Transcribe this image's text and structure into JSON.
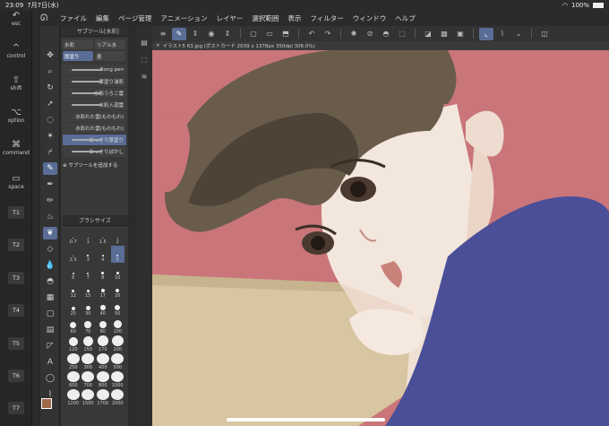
{
  "status": {
    "time": "23:09",
    "date": "7月7日(水)",
    "battery": "100%"
  },
  "menu": {
    "items": [
      "ファイル",
      "編集",
      "ページ管理",
      "アニメーション",
      "レイヤー",
      "選択範囲",
      "表示",
      "フィルター",
      "ウィンドウ",
      "ヘルプ"
    ]
  },
  "leftkeys": {
    "esc": "esc",
    "control": "control",
    "shift": "shift",
    "option": "option",
    "command": "command",
    "space": "space",
    "tkeys": [
      "T1",
      "T2",
      "T3",
      "T4",
      "T5",
      "T6",
      "T7"
    ]
  },
  "subtool": {
    "title": "サブツール[水彩]",
    "tabs": [
      "水彩",
      "リアル水",
      "厚塗り",
      "墨"
    ],
    "brushes": [
      "Bong pen",
      "厚塗り油彩",
      "水彩うろこ雲",
      "水彩入道雲",
      "水彩わた雲(もわもわ)",
      "水彩わた雲(もわもわ)",
      "あっさり厚塗り",
      "あっさりぼかし"
    ],
    "add_label": "サブツールを追加する"
  },
  "brushsize": {
    "title": "ブラシサイズ",
    "sizes": [
      "0.7",
      "1",
      "1.5",
      "2",
      "2.5",
      "3",
      "4",
      "5",
      "6",
      "7",
      "8",
      "10",
      "12",
      "15",
      "17",
      "20",
      "25",
      "30",
      "40",
      "50",
      "60",
      "70",
      "80",
      "100",
      "120",
      "150",
      "170",
      "200",
      "250",
      "300",
      "400",
      "500",
      "600",
      "700",
      "800",
      "1000",
      "1200",
      "1500",
      "1700",
      "2000"
    ]
  },
  "document": {
    "tab": "イラスト5 63.jpg (ポストカード 2039 x 1378px 350dpi 306.0%)"
  },
  "colors": {
    "accent": "#5a6d96",
    "bg": "#c9757a",
    "main_color": "#a0694a"
  }
}
